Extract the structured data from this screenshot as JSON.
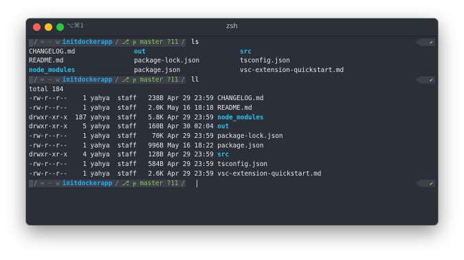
{
  "window": {
    "shortcut": "⌥⌘1",
    "title": "zsh"
  },
  "prompt": {
    "os_icon": "",
    "path_prefix": "≈ ~ w",
    "dir": "initdockerapp",
    "git": "⎇ ᵽ master ?11",
    "status": "✔"
  },
  "commands": [
    "ls",
    "ll",
    ""
  ],
  "ls_output": {
    "rows": [
      [
        {
          "text": "CHANGELOG.md",
          "dir": false
        },
        {
          "text": "out",
          "dir": true
        },
        {
          "text": "src",
          "dir": true
        }
      ],
      [
        {
          "text": "README.md",
          "dir": false
        },
        {
          "text": "package-lock.json",
          "dir": false
        },
        {
          "text": "tsconfig.json",
          "dir": false
        }
      ],
      [
        {
          "text": "node_modules",
          "dir": true
        },
        {
          "text": "package.json",
          "dir": false
        },
        {
          "text": "vsc-extension-quickstart.md",
          "dir": false
        }
      ]
    ]
  },
  "ll_output": {
    "total": "total 184",
    "rows": [
      {
        "meta": "-rw-r--r--    1 yahya  staff   238B Apr 29 23:59 ",
        "name": "CHANGELOG.md",
        "dir": false
      },
      {
        "meta": "-rw-r--r--    1 yahya  staff   2.0K May 16 18:18 ",
        "name": "README.md",
        "dir": false
      },
      {
        "meta": "drwxr-xr-x  187 yahya  staff   5.8K Apr 29 23:59 ",
        "name": "node_modules",
        "dir": true
      },
      {
        "meta": "drwxr-xr-x    5 yahya  staff   160B Apr 30 02:04 ",
        "name": "out",
        "dir": true
      },
      {
        "meta": "-rw-r--r--    1 yahya  staff    70K Apr 29 23:59 ",
        "name": "package-lock.json",
        "dir": false
      },
      {
        "meta": "-rw-r--r--    1 yahya  staff   996B May 16 18:22 ",
        "name": "package.json",
        "dir": false
      },
      {
        "meta": "drwxr-xr-x    4 yahya  staff   128B Apr 29 23:59 ",
        "name": "src",
        "dir": true
      },
      {
        "meta": "-rw-r--r--    1 yahya  staff   584B Apr 29 23:59 ",
        "name": "tsconfig.json",
        "dir": false
      },
      {
        "meta": "-rw-r--r--    1 yahya  staff   2.6K Apr 29 23:59 ",
        "name": "vsc-extension-quickstart.md",
        "dir": false
      }
    ]
  },
  "colors": {
    "background": "#2b2f37",
    "directory": "#27c3f0",
    "git": "#8bc34a",
    "text": "#e6e6e6"
  }
}
